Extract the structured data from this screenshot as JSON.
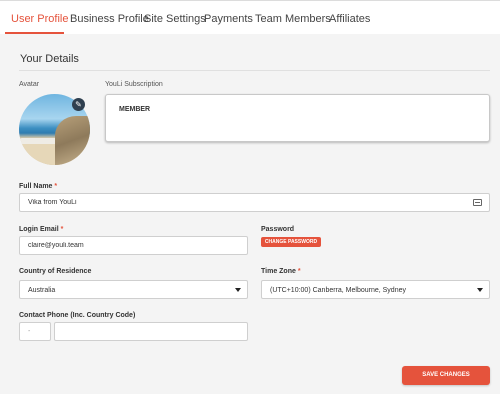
{
  "tabs": [
    {
      "label": "User Profile"
    },
    {
      "label": "Business Profile"
    },
    {
      "label": "Site Settings"
    },
    {
      "label": "Payments"
    },
    {
      "label": "Team Members"
    },
    {
      "label": "Affiliates"
    }
  ],
  "section": {
    "title": "Your Details"
  },
  "avatar": {
    "label": "Avatar"
  },
  "subscription": {
    "label": "YouLi Subscription",
    "value": "MEMBER"
  },
  "full_name": {
    "label": "Full Name",
    "required_mark": "*",
    "value": "Vika from YouLi"
  },
  "login_email": {
    "label": "Login Email",
    "required_mark": "*",
    "value": "claire@youli.team"
  },
  "password": {
    "label": "Password",
    "button": "CHANGE PASSWORD"
  },
  "country": {
    "label": "Country of Residence",
    "value": "Australia"
  },
  "timezone": {
    "label": "Time Zone",
    "required_mark": "*",
    "value": "(UTC+10:00) Canberra, Melbourne, Sydney"
  },
  "phone": {
    "label": "Contact Phone (Inc. Country Code)",
    "code_placeholder": "-",
    "number_value": ""
  },
  "save_button": "SAVE CHANGES",
  "colors": {
    "accent": "#e5533c",
    "background": "#f4f4f4",
    "edit_button": "#2f3f4f"
  },
  "icons": {
    "edit": "pencil-icon",
    "card": "id-card-icon",
    "dropdown": "caret-down-icon"
  }
}
